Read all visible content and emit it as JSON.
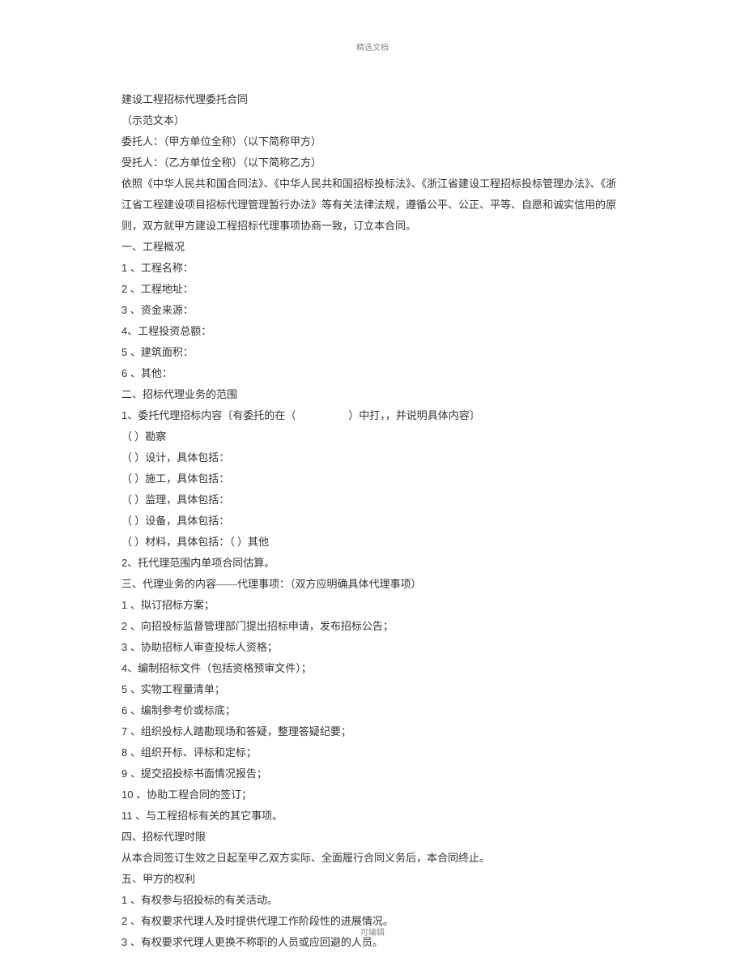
{
  "header": "精选文档",
  "footer": "可编辑",
  "title": "建设工程招标代理委托合同",
  "subtitle": "（示范文本）",
  "parties": {
    "client": "委托人：（甲方单位全称）（以下简称甲方）",
    "trustee": "受托人：（乙方单位全称）（以下简称乙方）"
  },
  "preamble": "依照《中华人民共和国合同法》、《中华人民共和国招标投标法》、《浙江省建设工程招标投标管理办法》、《浙江省工程建设项目招标代理管理暂行办法》等有关法律法规，遵循公平、公正、平等、自愿和诚实信用的原则，双方就甲方建设工程招标代理事项协商一致，订立本合同。",
  "section1": {
    "heading": "一、工程概况",
    "items": [
      "1 、工程名称：",
      "2 、工程地址：",
      "3 、资金来源：",
      "4、工程投资总额：",
      "5 、建筑面积：",
      "6 、其他："
    ]
  },
  "section2": {
    "heading": "二、招标代理业务的范围",
    "item1": "1、委托代理招标内容〔有委托的在（　　　　　）中打，，并说明具体内容〕",
    "options": [
      "（ ）勘察",
      "（ ）设计，具体包括：",
      "（ ）施工，具体包括：",
      "（ ）监理，具体包括：",
      "（ ）设备，具体包括：",
      "（ ）材料，具体包括：（ ）其他"
    ],
    "item2": "2、托代理范围内单项合同估算。"
  },
  "section3": {
    "heading": "三、代理业务的内容——代理事项：（双方应明确具体代理事项）",
    "items": [
      "1 、拟订招标方案；",
      "2 、向招投标监督管理部门提出招标申请，发布招标公告；",
      "3 、协助招标人审查投标人资格；",
      "4、编制招标文件（包括资格预审文件）；",
      "5 、实物工程量清单；",
      "6 、编制参考价或标底；",
      "7 、组织投标人踏勘现场和答疑，整理答疑纪要；",
      "8 、组织开标、评标和定标；",
      "9 、提交招投标书面情况报告；",
      "10 、协助工程合同的签订；",
      "11 、与工程招标有关的其它事项。"
    ]
  },
  "section4": {
    "heading": "四、招标代理时限",
    "text": "从本合同签订生效之日起至甲乙双方实际、全面履行合同义务后，本合同终止。"
  },
  "section5": {
    "heading": "五、甲方的权利",
    "items": [
      "1 、有权参与招投标的有关活动。",
      "2 、有权要求代理人及时提供代理工作阶段性的进展情况。",
      "3 、有权要求代理人更换不称职的人员或应回避的人员。"
    ]
  }
}
